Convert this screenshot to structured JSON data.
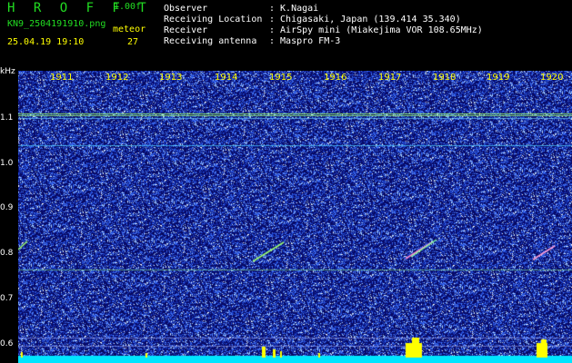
{
  "header": {
    "app_title": "H R O F F T",
    "version": "1.00f",
    "filename": "KN9_2504191910.png",
    "meteor_label": "meteor",
    "datetime": "25.04.19 19:10",
    "meteor_count": "27",
    "info_rows": [
      {
        "label": "Observer",
        "value": ": K.Nagai"
      },
      {
        "label": "Receiving Location",
        "value": ": Chigasaki, Japan (139.414 35.340)"
      },
      {
        "label": "Receiver",
        "value": ": AirSpy mini (Miakejima VOR 108.65MHz)"
      },
      {
        "label": "Receiving antenna",
        "value": ": Maspro FM-3"
      }
    ]
  },
  "y_axis": {
    "unit": "kHz",
    "ticks": [
      "1.1",
      "1.0",
      "0.9",
      "0.8",
      "0.7",
      "0.6"
    ]
  },
  "x_axis": {
    "ticks": [
      "1911",
      "1912",
      "1913",
      "1914",
      "1915",
      "1916",
      "1917",
      "1918",
      "1919",
      "1920"
    ]
  },
  "colors": {
    "background": "#000000",
    "spectrum_dark": "#0a0a66",
    "spectrum_noise": "#3c6cff",
    "carrier_line": "#9cff6e",
    "floor_bar": "#00e5ff",
    "meteor_burst": "#ffff00"
  }
}
